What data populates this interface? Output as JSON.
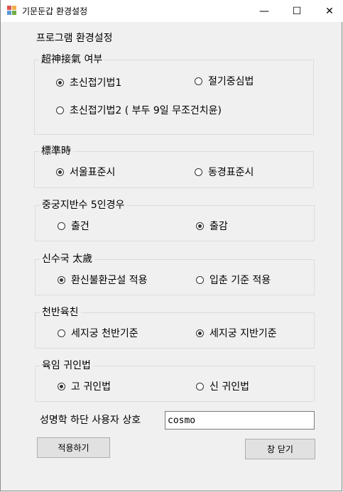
{
  "window": {
    "title": "기문둔갑 환경설정"
  },
  "titlebar": {
    "minimize": "—",
    "maximize": "☐",
    "close": "✕"
  },
  "heading": "프로그램 환경설정",
  "groups": [
    {
      "label": "超神接氣 여부",
      "options": [
        "초신접기법1",
        "절기중심법",
        "초신접기법2 ( 부두 9일 무조건치윤)"
      ],
      "selected": 0
    },
    {
      "label": "標準時",
      "options": [
        "서울표준시",
        "동경표준시"
      ],
      "selected": 0
    },
    {
      "label": "중궁지반수 5인경우",
      "options": [
        "출건",
        "출감"
      ],
      "selected": 1
    },
    {
      "label": "신수국 太歲",
      "options": [
        "환신불환군설 적용",
        "입춘 기준 적용"
      ],
      "selected": 0
    },
    {
      "label": "천반육친",
      "options": [
        "세지궁 천반기준",
        "세지궁 지반기준"
      ],
      "selected": 1
    },
    {
      "label": "육임 귀인법",
      "options": [
        "고 귀인법",
        "신 귀인법"
      ],
      "selected": 0
    }
  ],
  "user_name": {
    "label": "성명학 하단 사용자 상호",
    "value": "cosmo"
  },
  "buttons": {
    "apply": "적용하기",
    "close": "창 닫기"
  }
}
